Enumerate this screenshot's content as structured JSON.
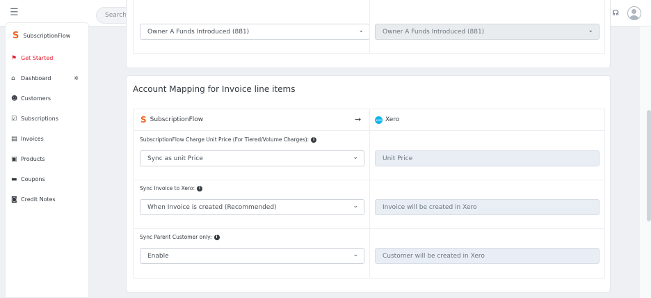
{
  "topbar": {
    "search_placeholder": "Search e.g \"John Doe\"",
    "icons": [
      "plus-icon",
      "moon-icon",
      "mail-icon",
      "calendar-icon",
      "settings-icon",
      "notification-icon",
      "headset-icon",
      "user-avatar"
    ]
  },
  "sidebar": {
    "brand": "SubscriptionFlow",
    "items": [
      {
        "label": "Get Started",
        "icon": "flag-icon",
        "active": true
      },
      {
        "label": "Dashboard",
        "icon": "home-icon"
      },
      {
        "label": "Customers",
        "icon": "users-icon"
      },
      {
        "label": "Subscriptions",
        "icon": "calendar-check-icon"
      },
      {
        "label": "Invoices",
        "icon": "invoice-icon"
      },
      {
        "label": "Products",
        "icon": "box-icon"
      },
      {
        "label": "Coupons",
        "icon": "coupon-icon"
      },
      {
        "label": "Credit Notes",
        "icon": "credit-note-icon"
      }
    ]
  },
  "top_section": {
    "left_select": "Owner A Funds Introduced (881)",
    "right_select": "Owner A Funds Introduced (881)"
  },
  "main": {
    "title": "Account Mapping for Invoice line items",
    "source": "SubscriptionFlow",
    "arrow": "→",
    "target": "Xero",
    "xero_badge": "xero",
    "rows": [
      {
        "label": "SubscriptionFlow Charge Unit Price (For Tiered/Volume Charges):",
        "select": "Sync as unit Price",
        "target": "Unit Price"
      },
      {
        "label": "Sync Invoice to Xero:",
        "select": "When Invoice is created (Recommended)",
        "target": "Invoice will be created in Xero"
      },
      {
        "label": "Sync Parent Customer only:",
        "select": "Enable",
        "target": "Customer will be created in Xero"
      }
    ]
  },
  "colors": {
    "accent": "#e31b2c",
    "brand": "#f26522",
    "xero": "#13b5ea"
  }
}
